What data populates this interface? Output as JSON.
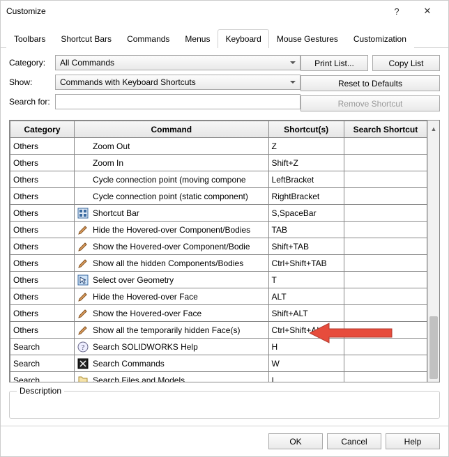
{
  "window": {
    "title": "Customize"
  },
  "tabs": [
    "Toolbars",
    "Shortcut Bars",
    "Commands",
    "Menus",
    "Keyboard",
    "Mouse Gestures",
    "Customization"
  ],
  "activeTab": "Keyboard",
  "labels": {
    "category": "Category:",
    "show": "Show:",
    "search_for": "Search for:",
    "description": "Description"
  },
  "dropdowns": {
    "category": "All Commands",
    "show": "Commands with Keyboard Shortcuts"
  },
  "search": {
    "value": ""
  },
  "buttons": {
    "print_list": "Print List...",
    "copy_list": "Copy List",
    "reset_defaults": "Reset to Defaults",
    "remove_shortcut": "Remove Shortcut",
    "ok": "OK",
    "cancel": "Cancel",
    "help": "Help"
  },
  "table": {
    "headers": {
      "category": "Category",
      "command": "Command",
      "shortcuts": "Shortcut(s)",
      "search_shortcut": "Search Shortcut"
    },
    "rows": [
      {
        "category": "Others",
        "icon": null,
        "command": "Zoom Out",
        "shortcut": "Z",
        "ss": ""
      },
      {
        "category": "Others",
        "icon": null,
        "command": "Zoom In",
        "shortcut": "Shift+Z",
        "ss": ""
      },
      {
        "category": "Others",
        "icon": null,
        "command": "Cycle connection point (moving compone",
        "shortcut": "LeftBracket",
        "ss": ""
      },
      {
        "category": "Others",
        "icon": null,
        "command": "Cycle connection point (static component)",
        "shortcut": "RightBracket",
        "ss": ""
      },
      {
        "category": "Others",
        "icon": "shortcut",
        "command": "Shortcut Bar",
        "shortcut": "S,SpaceBar",
        "ss": ""
      },
      {
        "category": "Others",
        "icon": "pencil",
        "command": "Hide the Hovered-over Component/Bodies",
        "shortcut": "TAB",
        "ss": ""
      },
      {
        "category": "Others",
        "icon": "pencil",
        "command": "Show the Hovered-over Component/Bodie",
        "shortcut": "Shift+TAB",
        "ss": ""
      },
      {
        "category": "Others",
        "icon": "pencil",
        "command": "Show all the hidden Components/Bodies",
        "shortcut": "Ctrl+Shift+TAB",
        "ss": ""
      },
      {
        "category": "Others",
        "icon": "select",
        "command": "Select over Geometry",
        "shortcut": "T",
        "ss": ""
      },
      {
        "category": "Others",
        "icon": "pencil",
        "command": "Hide the Hovered-over Face",
        "shortcut": "ALT",
        "ss": ""
      },
      {
        "category": "Others",
        "icon": "pencil",
        "command": "Show the Hovered-over Face",
        "shortcut": "Shift+ALT",
        "ss": ""
      },
      {
        "category": "Others",
        "icon": "pencil",
        "command": "Show all the temporarily hidden Face(s)",
        "shortcut": "Ctrl+Shift+ALT",
        "ss": ""
      },
      {
        "category": "Search",
        "icon": "help",
        "command": "Search SOLIDWORKS Help",
        "shortcut": "H",
        "ss": ""
      },
      {
        "category": "Search",
        "icon": "searchcmd",
        "command": "Search Commands",
        "shortcut": "W",
        "ss": ""
      },
      {
        "category": "Search",
        "icon": "files",
        "command": "Search Files and Models",
        "shortcut": "I",
        "ss": ""
      }
    ]
  }
}
